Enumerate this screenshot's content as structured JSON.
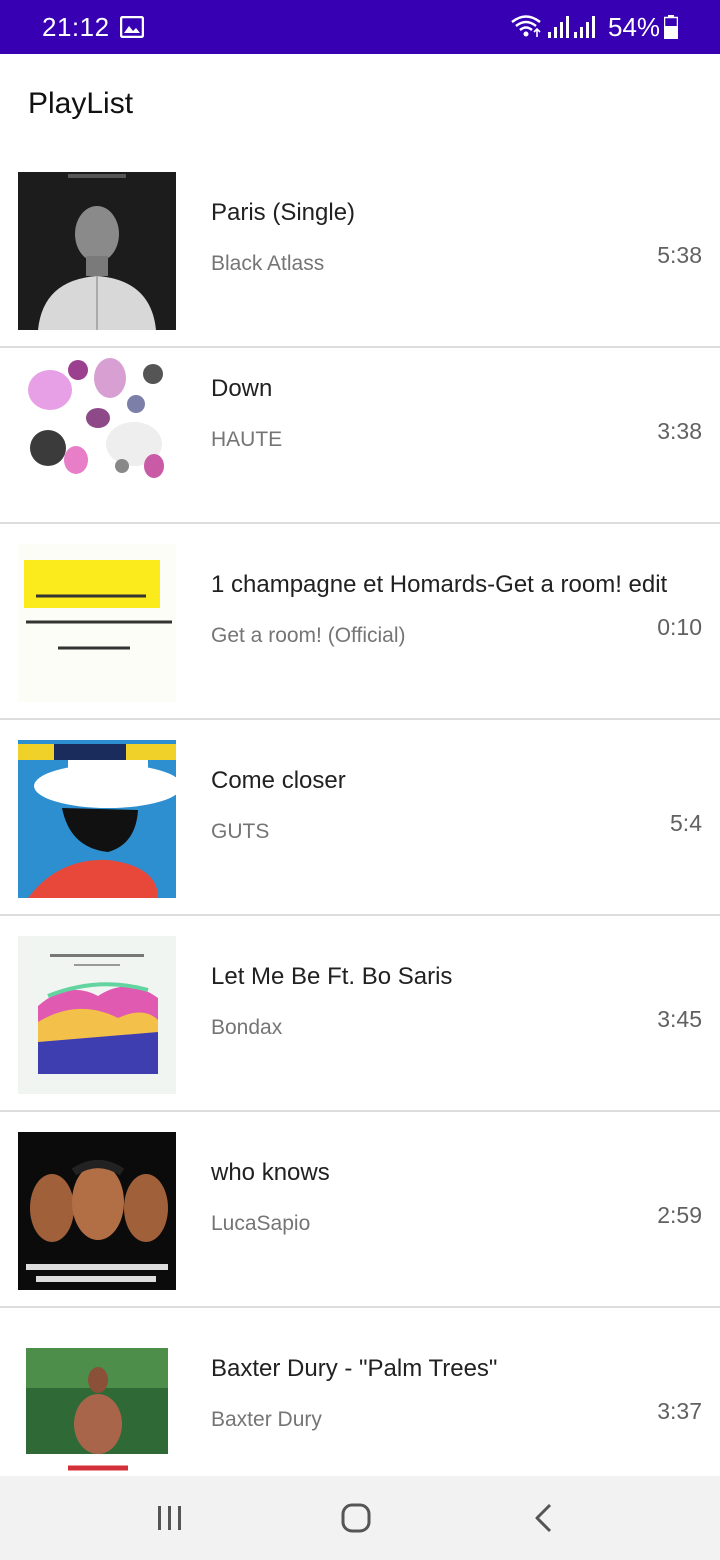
{
  "status_bar": {
    "time": "21:12",
    "battery": "54%",
    "icons": [
      "gallery-icon",
      "wifi-icon",
      "signal-icon",
      "signal-icon",
      "battery-icon"
    ],
    "background": "#3700b3"
  },
  "header": {
    "title": "PlayList"
  },
  "playlist": {
    "tracks": [
      {
        "title": "Paris (Single)",
        "artist": "Black Atlass",
        "duration": "5:38"
      },
      {
        "title": "Down",
        "artist": "HAUTE",
        "duration": "3:38"
      },
      {
        "title": "1 champagne et Homards-Get a room! edit",
        "artist": "Get a room! (Official)",
        "duration": "0:10"
      },
      {
        "title": "Come closer",
        "artist": "GUTS",
        "duration": "5:4"
      },
      {
        "title": "Let Me Be Ft. Bo Saris",
        "artist": "Bondax",
        "duration": "3:45"
      },
      {
        "title": "who knows",
        "artist": "LucaSapio",
        "duration": "2:59"
      },
      {
        "title": "Baxter Dury - \"Palm Trees\"",
        "artist": "Baxter Dury",
        "duration": "3:37"
      }
    ]
  },
  "nav_bar": {
    "icons": [
      "recent-apps-icon",
      "home-icon",
      "back-icon"
    ]
  }
}
